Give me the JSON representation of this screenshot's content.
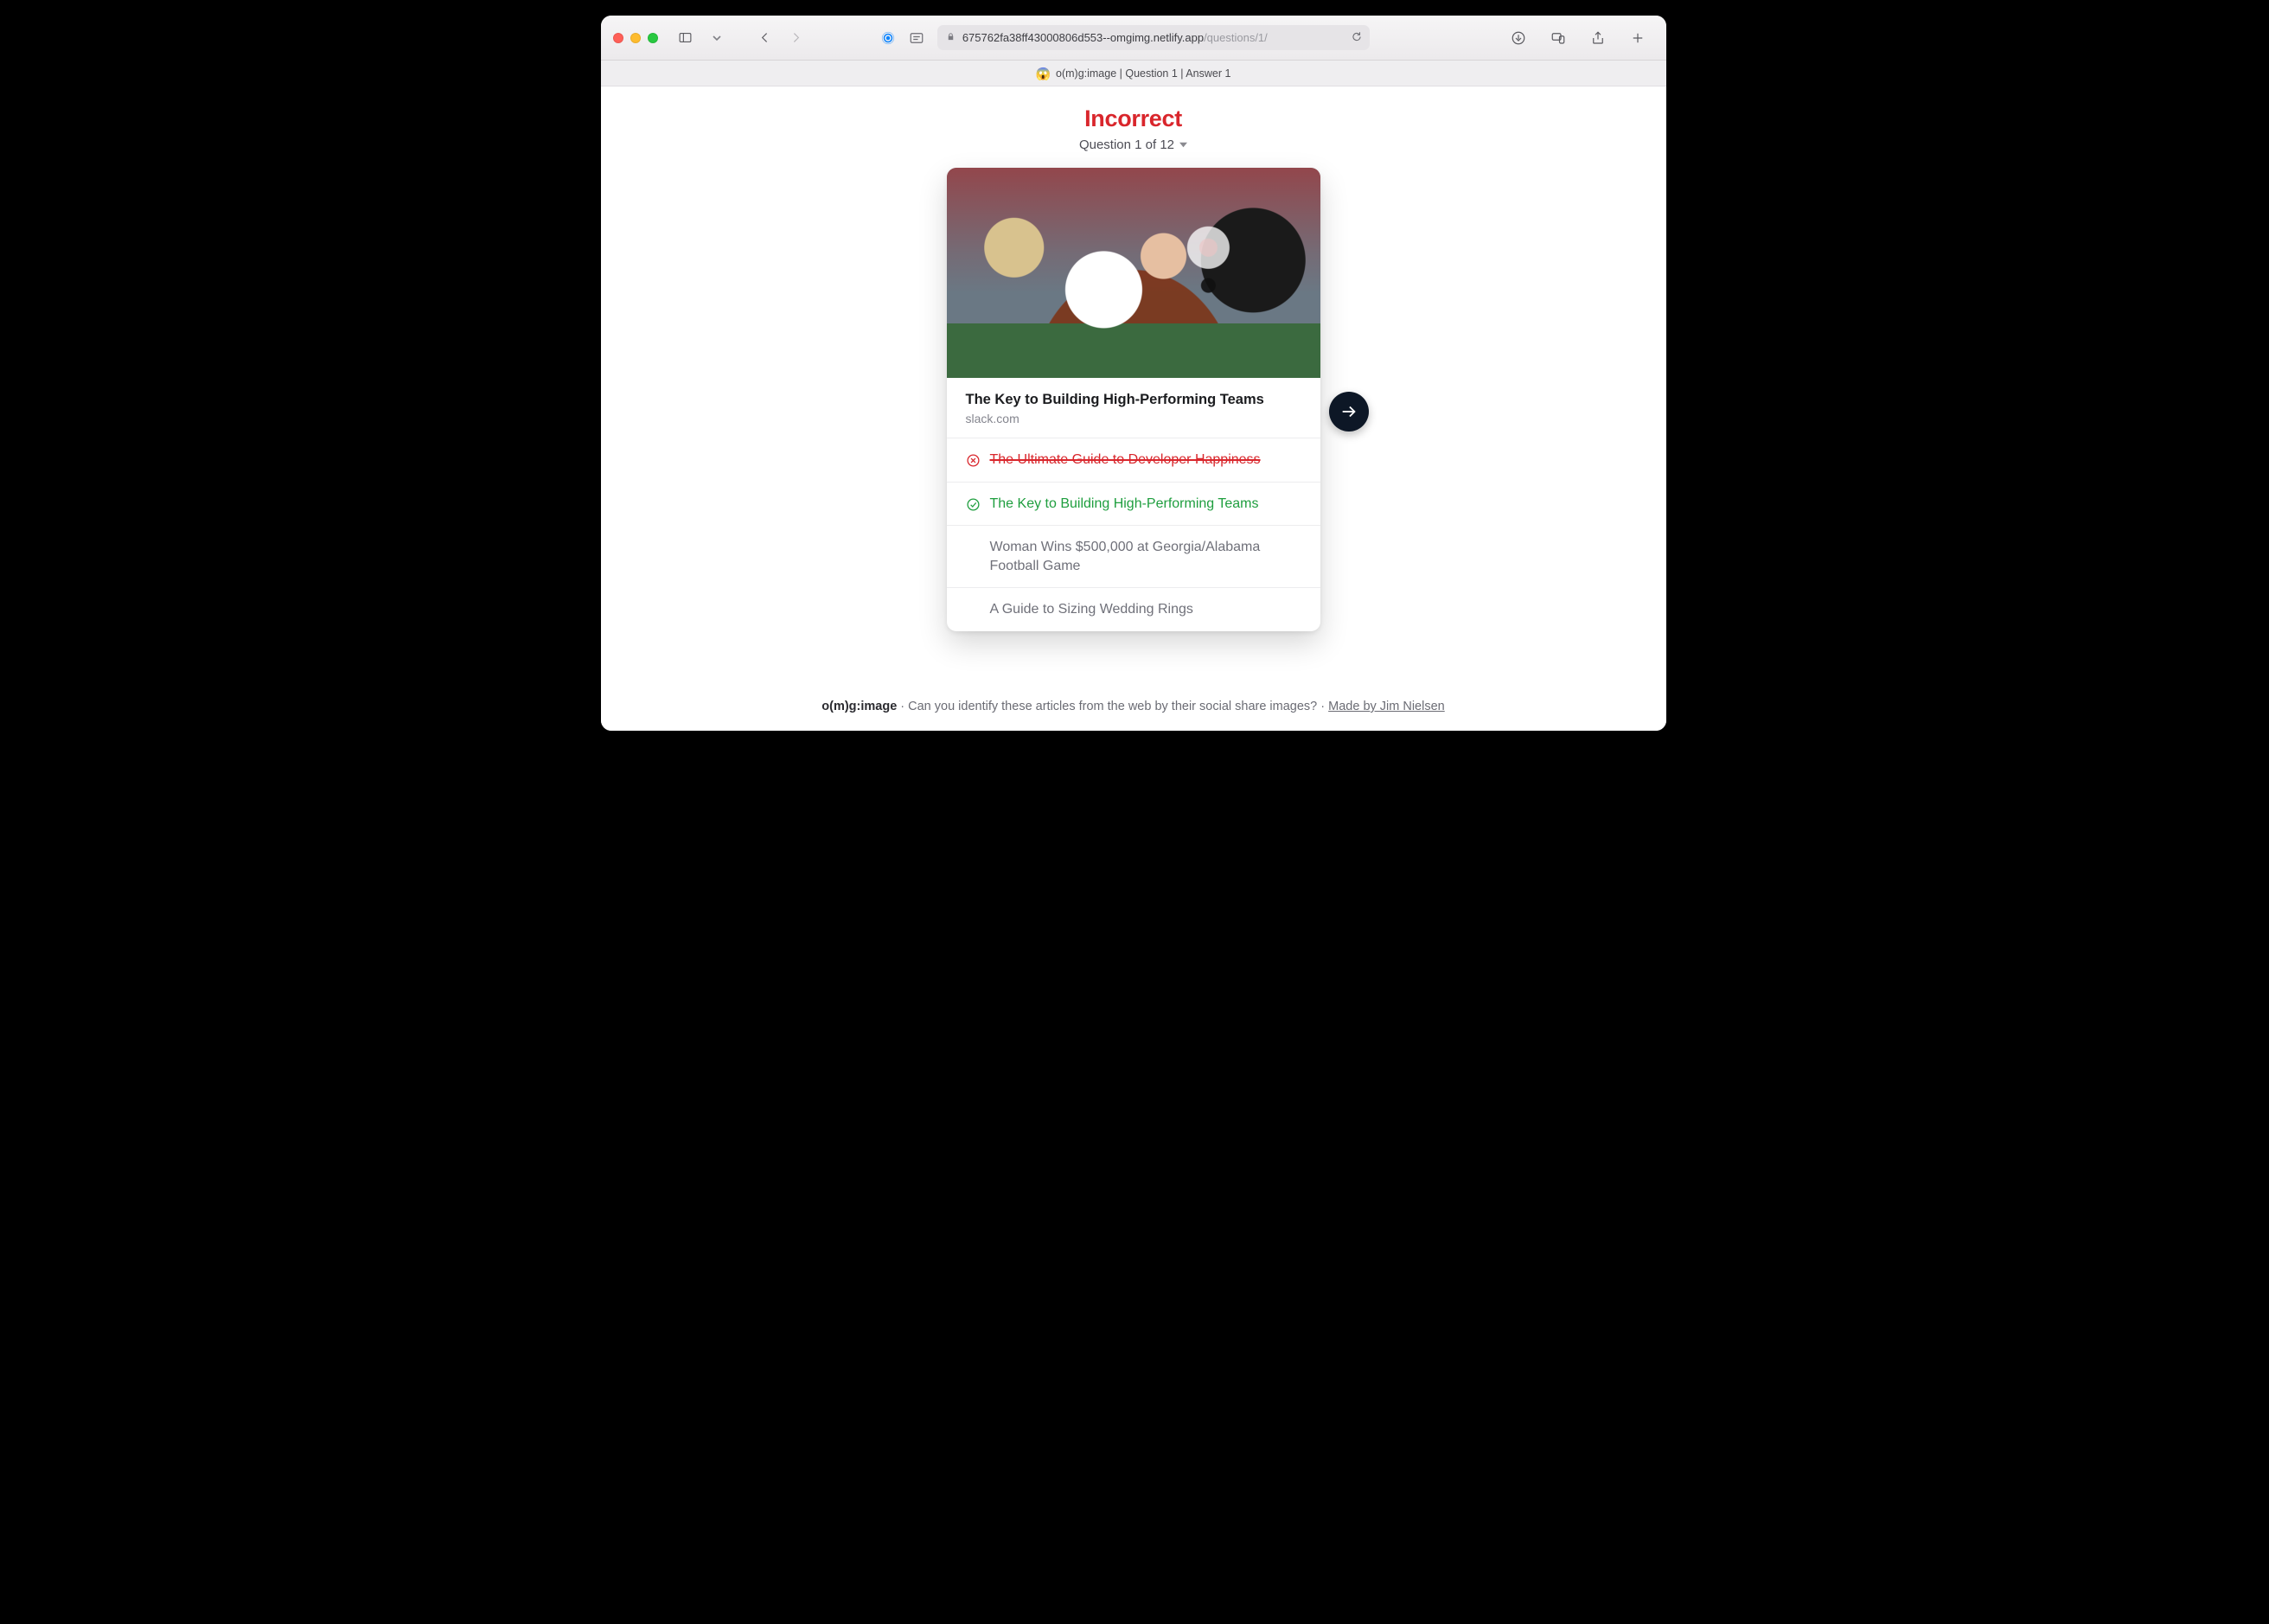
{
  "browser": {
    "url_host": "675762fa38ff43000806d553--omgimg.netlify.app",
    "url_path": "/questions/1/",
    "tab_emoji": "😱",
    "tab_title": "o(m)g:image | Question 1 | Answer 1"
  },
  "header": {
    "result_label": "Incorrect",
    "result_state": "incorrect",
    "question_counter": "Question 1 of 12"
  },
  "card": {
    "title": "The Key to Building High-Performing Teams",
    "domain": "slack.com"
  },
  "answers": [
    {
      "state": "wrong",
      "text": "The Ultimate Guide to Developer Happiness"
    },
    {
      "state": "correct",
      "text": "The Key to Building High-Performing Teams"
    },
    {
      "state": "other",
      "text": "Woman Wins $500,000 at Georgia/Alabama Football Game"
    },
    {
      "state": "other",
      "text": "A Guide to Sizing Wedding Rings"
    }
  ],
  "footer": {
    "brand": "o(m)g:image",
    "tagline": " · Can you identify these articles from the web by their social share images? · ",
    "credit": "Made by Jim Nielsen"
  }
}
